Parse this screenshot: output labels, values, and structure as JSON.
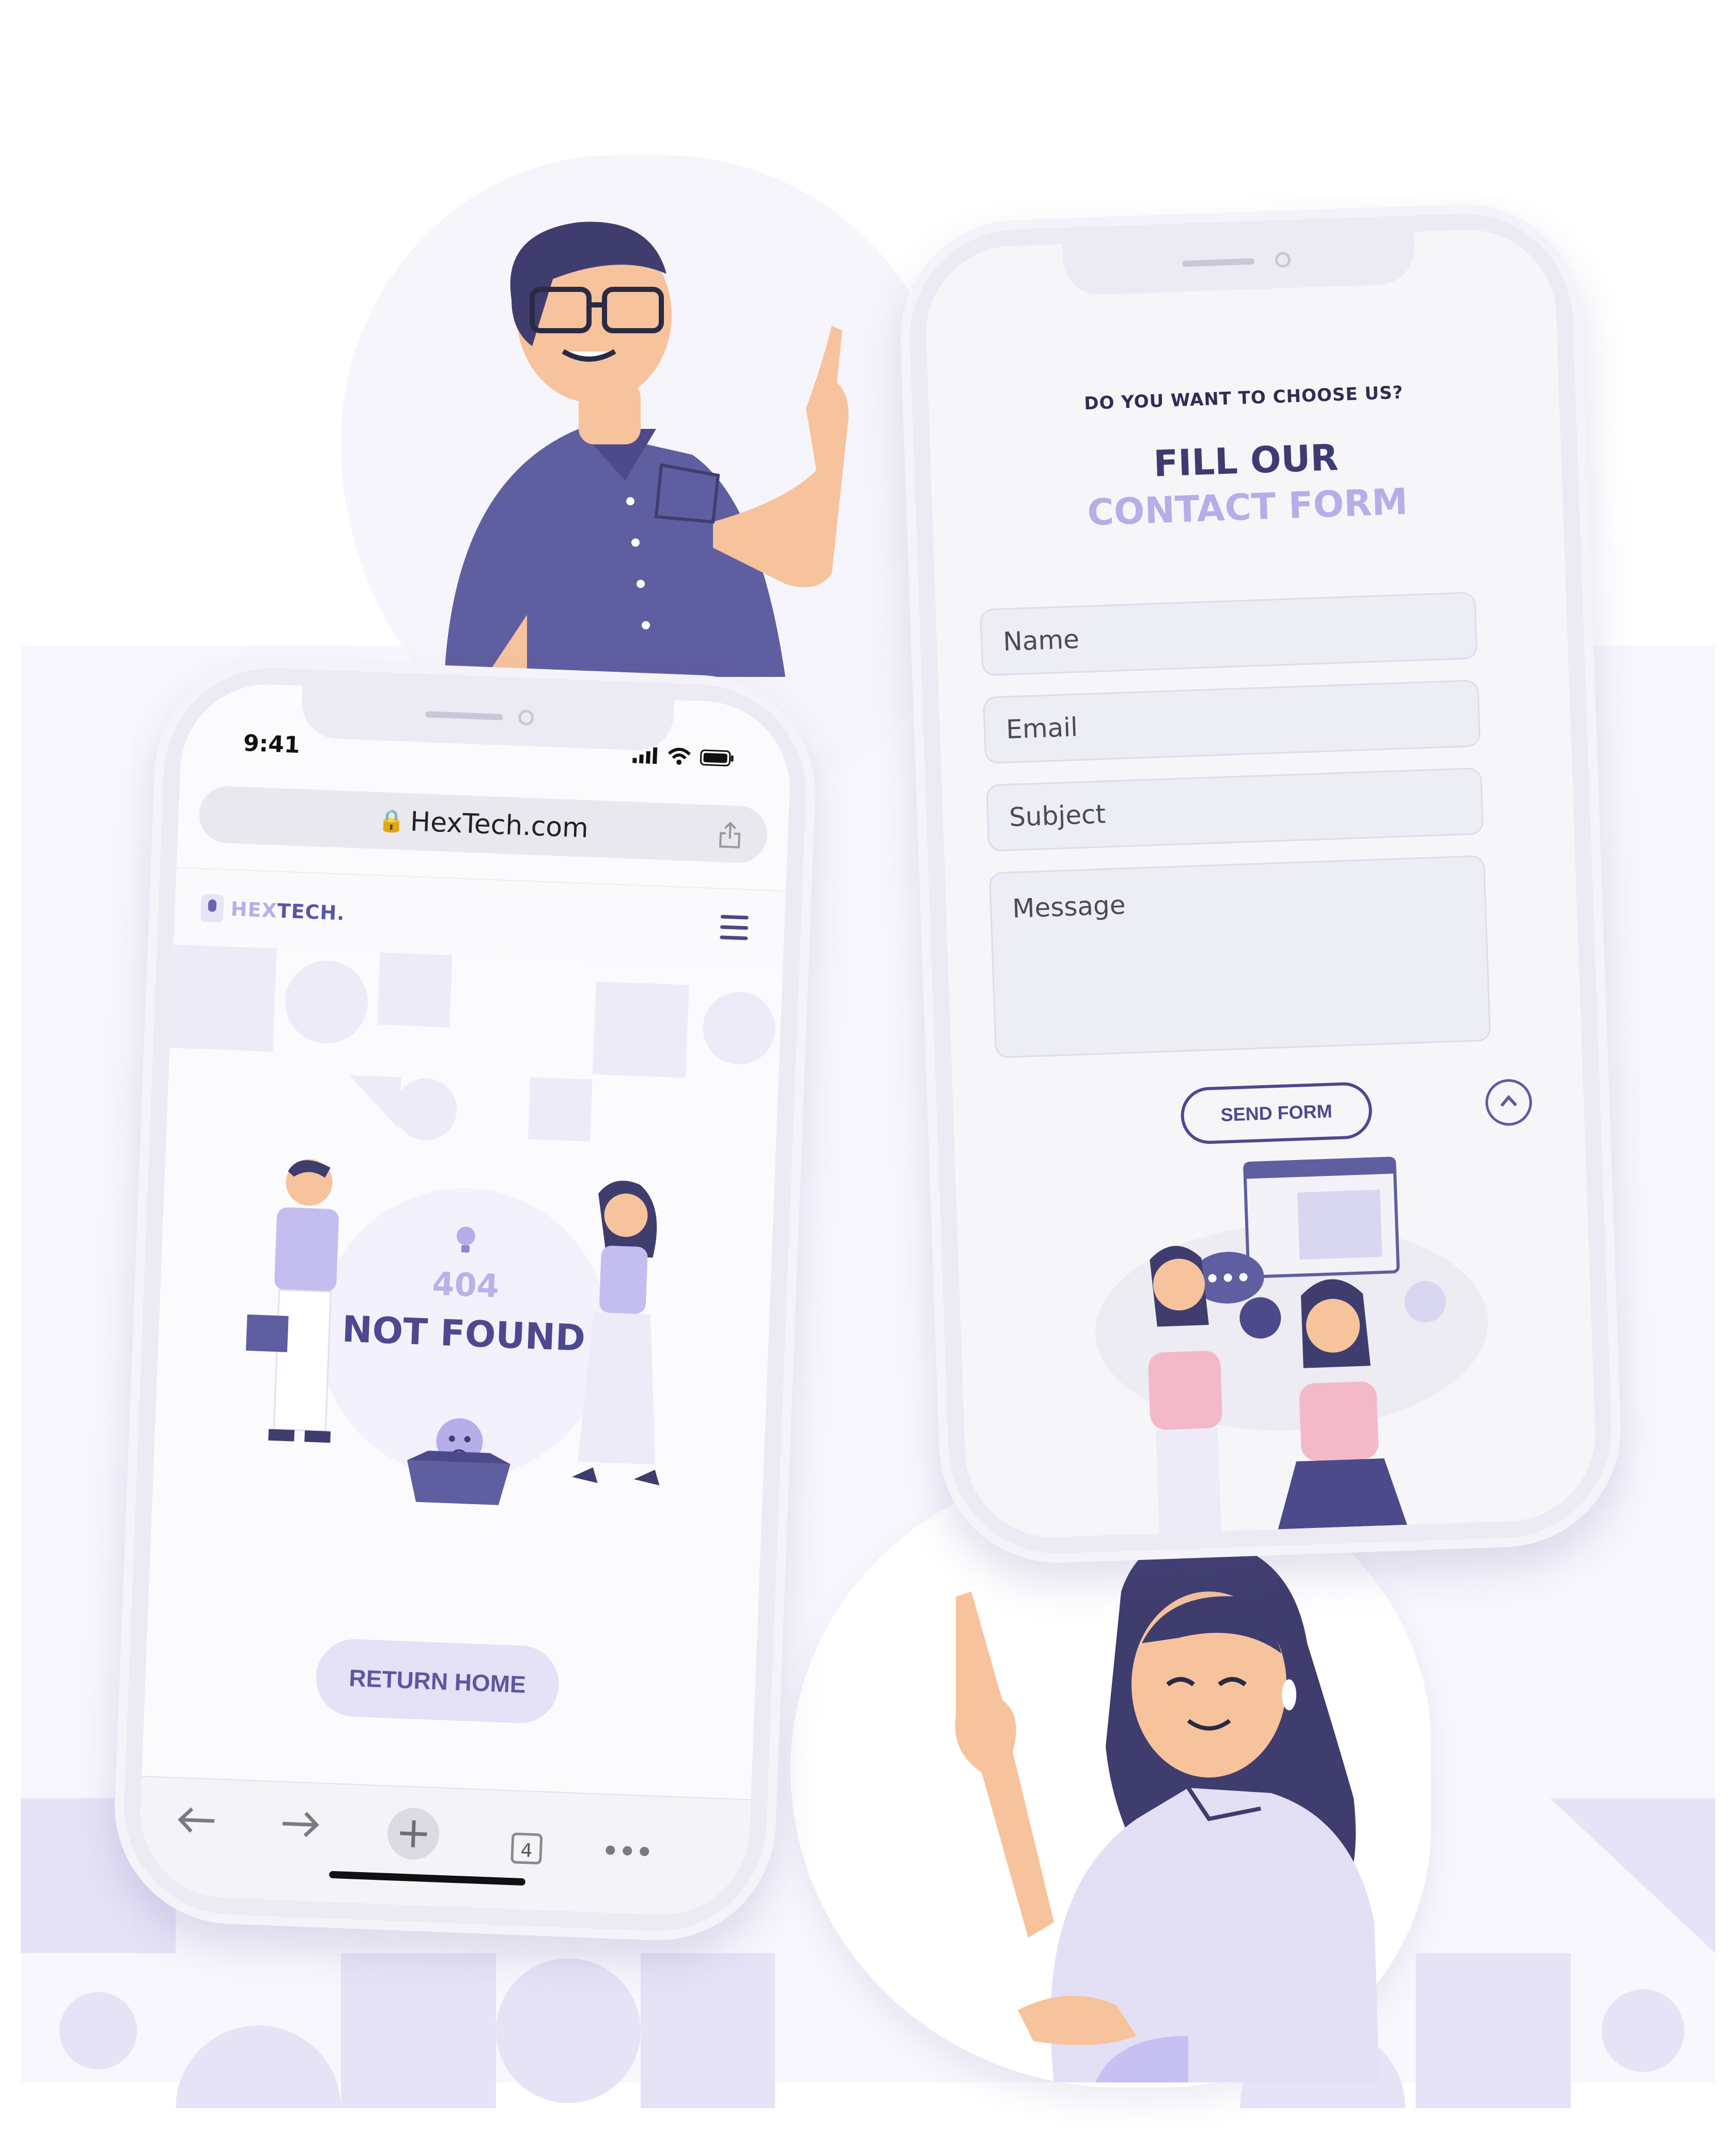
{
  "colors": {
    "primary": "#4e4890",
    "accent": "#b6aee8",
    "soft": "#e5e1f6",
    "background": "#f8f7fd"
  },
  "left_phone": {
    "status": {
      "time": "9:41"
    },
    "browser": {
      "url": "HexTech.com"
    },
    "site": {
      "logo_hex": "HEX",
      "logo_tech": "TECH.",
      "menu_icon": "hamburger-icon"
    },
    "error": {
      "code": "404",
      "title": "NOT FOUND",
      "return_button": "RETURN HOME"
    },
    "toolbar": {
      "back_icon": "arrow-left-icon",
      "forward_icon": "arrow-right-icon",
      "new_tab_icon": "plus-icon",
      "tab_count": "4",
      "more_icon": "more-icon"
    }
  },
  "right_phone": {
    "kicker": "DO YOU WANT TO CHOOSE US?",
    "title_line1": "FILL OUR",
    "title_line2": "CONTACT FORM",
    "form": {
      "name_placeholder": "Name",
      "email_placeholder": "Email",
      "subject_placeholder": "Subject",
      "message_placeholder": "Message",
      "send_button": "SEND FORM"
    },
    "scroll_icon": "chevron-up-icon"
  }
}
